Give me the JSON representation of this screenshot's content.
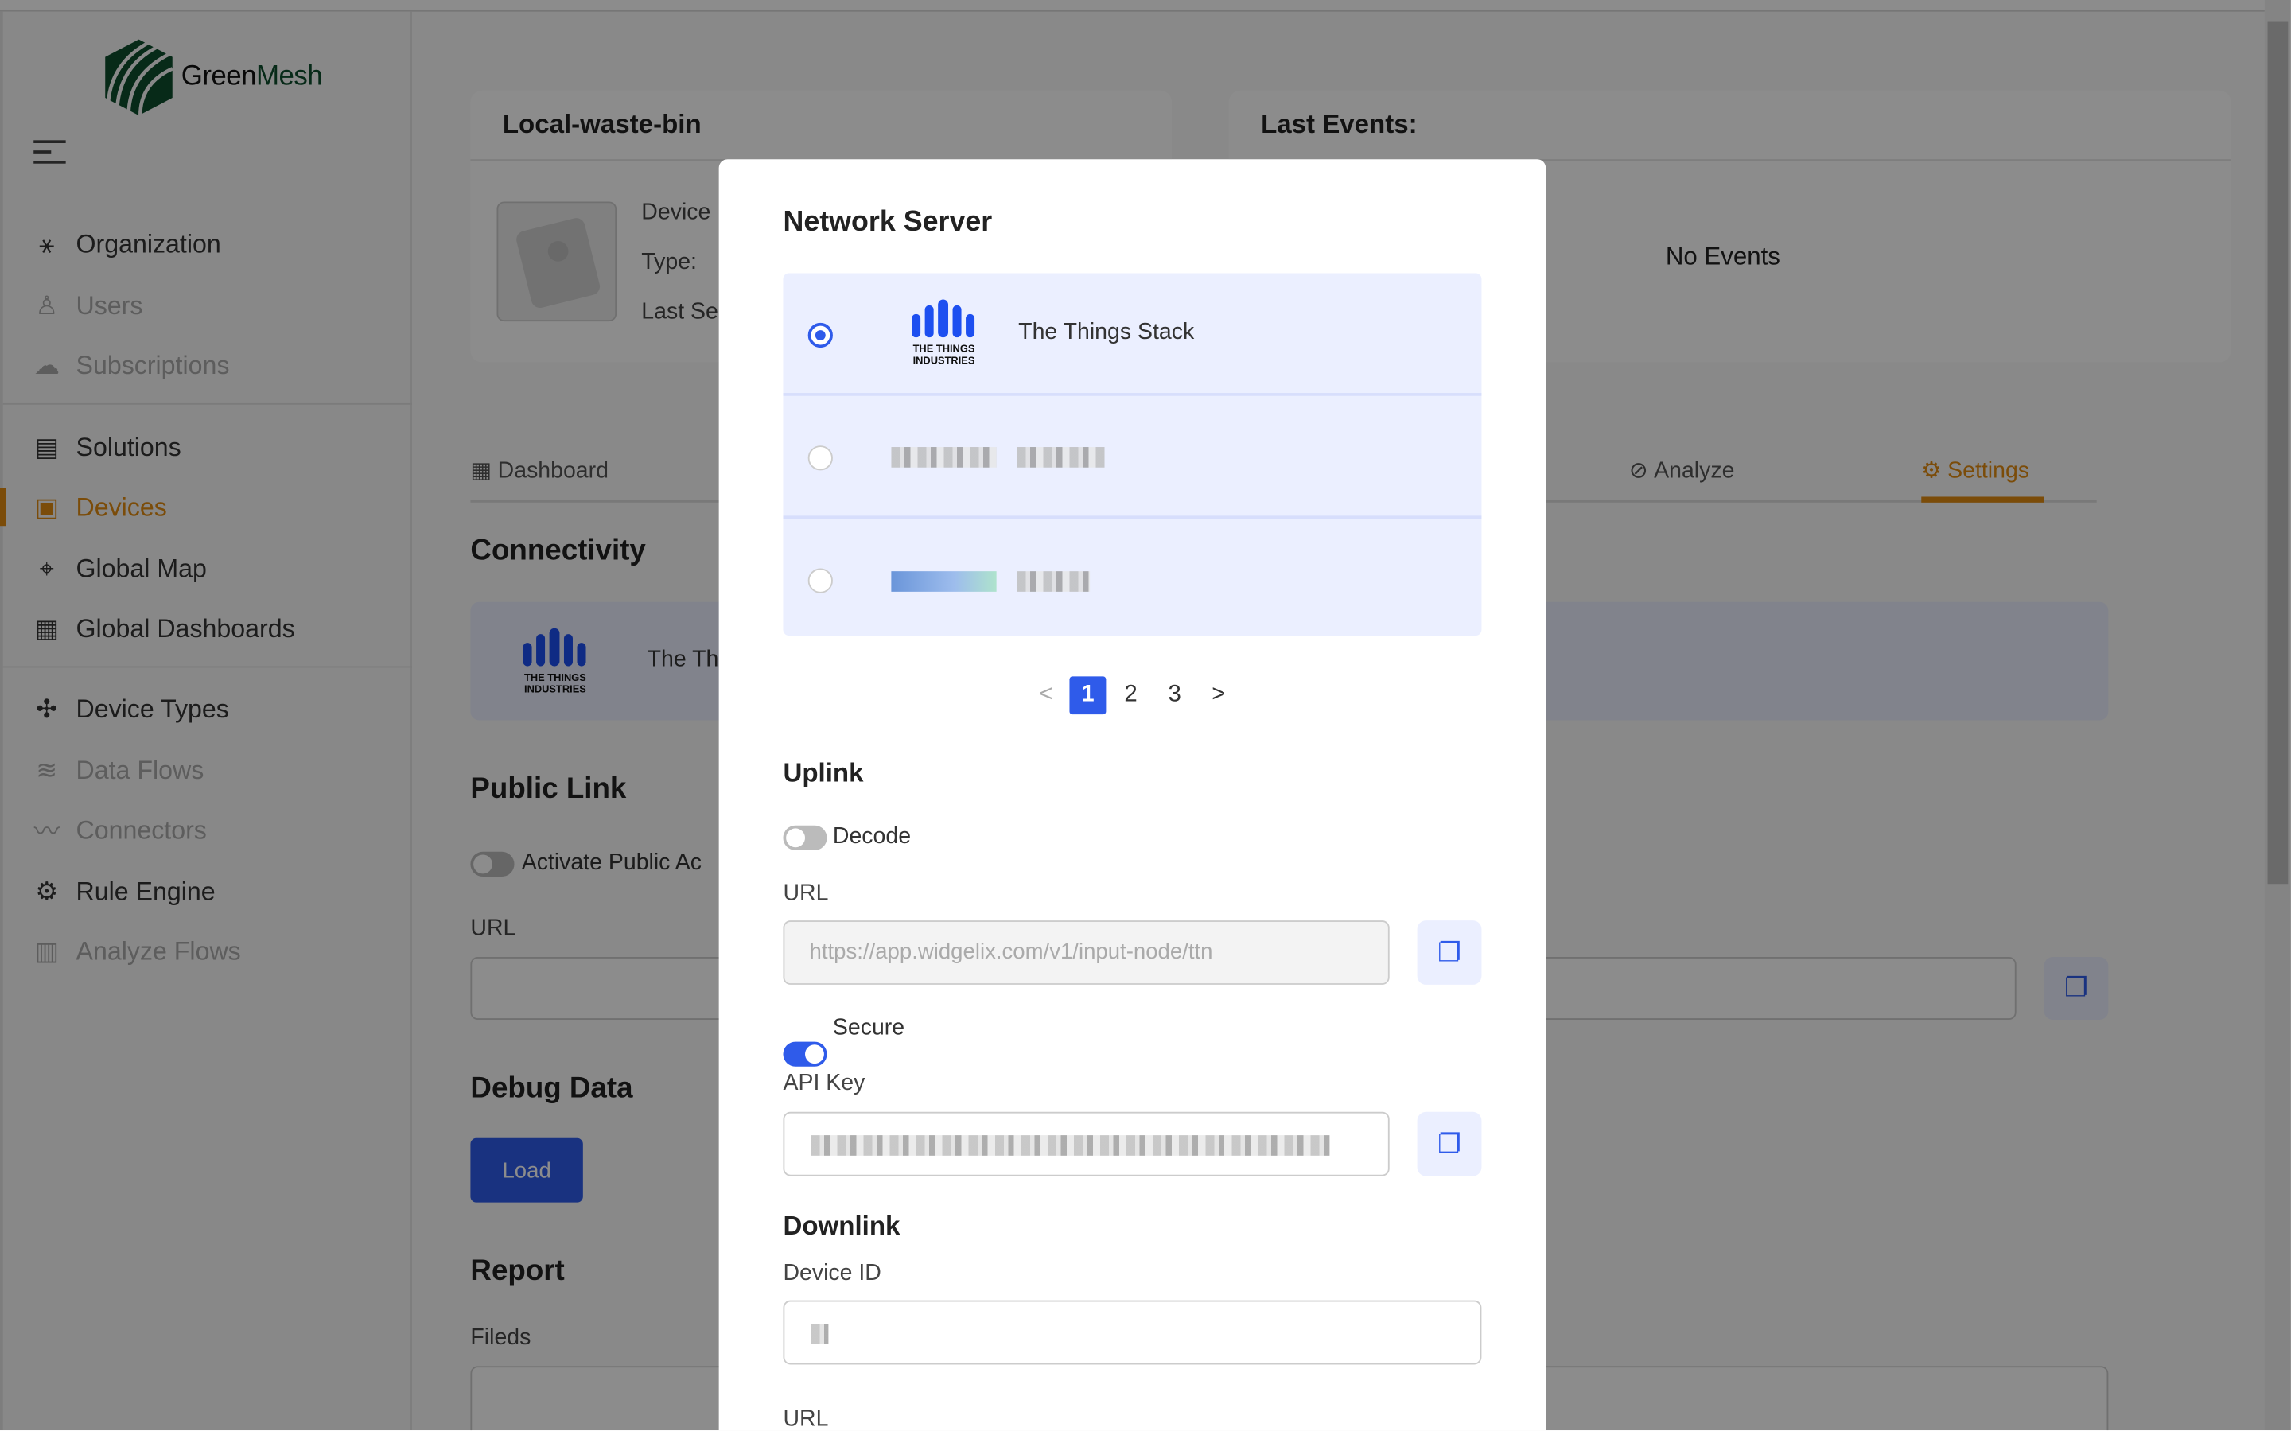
{
  "brand": {
    "name_part1": "Green",
    "name_part2": "Mesh"
  },
  "sidebar": {
    "items": [
      {
        "label": "Organization",
        "icon": "network-icon",
        "disabled": false
      },
      {
        "label": "Users",
        "icon": "users-icon",
        "disabled": true
      },
      {
        "label": "Subscriptions",
        "icon": "cloud-icon",
        "disabled": true
      },
      {
        "label": "Solutions",
        "icon": "solutions-icon",
        "disabled": false
      },
      {
        "label": "Devices",
        "icon": "chip-icon",
        "disabled": false,
        "active": true
      },
      {
        "label": "Global Map",
        "icon": "map-pin-icon",
        "disabled": false
      },
      {
        "label": "Global Dashboards",
        "icon": "dashboard-icon",
        "disabled": false
      },
      {
        "label": "Device Types",
        "icon": "puzzle-icon",
        "disabled": false
      },
      {
        "label": "Data Flows",
        "icon": "database-icon",
        "disabled": true
      },
      {
        "label": "Connectors",
        "icon": "connector-icon",
        "disabled": true
      },
      {
        "label": "Rule Engine",
        "icon": "gear-icon",
        "disabled": false
      },
      {
        "label": "Analyze Flows",
        "icon": "presentation-icon",
        "disabled": true
      }
    ]
  },
  "device": {
    "title": "Local-waste-bin",
    "fields": [
      "Device",
      "Type:",
      "Last Se"
    ]
  },
  "events": {
    "title": "Last Events:",
    "empty": "No Events"
  },
  "tabs": {
    "dashboard": "Dashboard",
    "analyze": "Analyze",
    "settings": "Settings"
  },
  "page": {
    "connectivity": "Connectivity",
    "conn_name": "The Th",
    "public_link": "Public Link",
    "activate": "Activate Public Ac",
    "url_label": "URL",
    "debug": "Debug Data",
    "load": "Load",
    "report": "Report",
    "fields": "Fileds"
  },
  "logo_tti": {
    "line1": "THE THINGS",
    "line2": "INDUSTRIES"
  },
  "modal": {
    "title": "Network Server",
    "servers": [
      {
        "label": "The Things Stack",
        "selected": true
      }
    ],
    "pagination": {
      "prev": "<",
      "pages": [
        "1",
        "2",
        "3"
      ],
      "current": "1",
      "next": ">"
    },
    "uplink": {
      "heading": "Uplink",
      "decode_label": "Decode",
      "decode_on": false,
      "url_label": "URL",
      "url_value": "https://app.widgelix.com/v1/input-node/ttn",
      "secure_label": "Secure",
      "secure_on": true,
      "api_key_label": "API Key"
    },
    "downlink": {
      "heading": "Downlink",
      "device_id_label": "Device ID",
      "url_label": "URL"
    }
  },
  "colors": {
    "accent": "#2f5bea",
    "active": "#e08a12"
  }
}
